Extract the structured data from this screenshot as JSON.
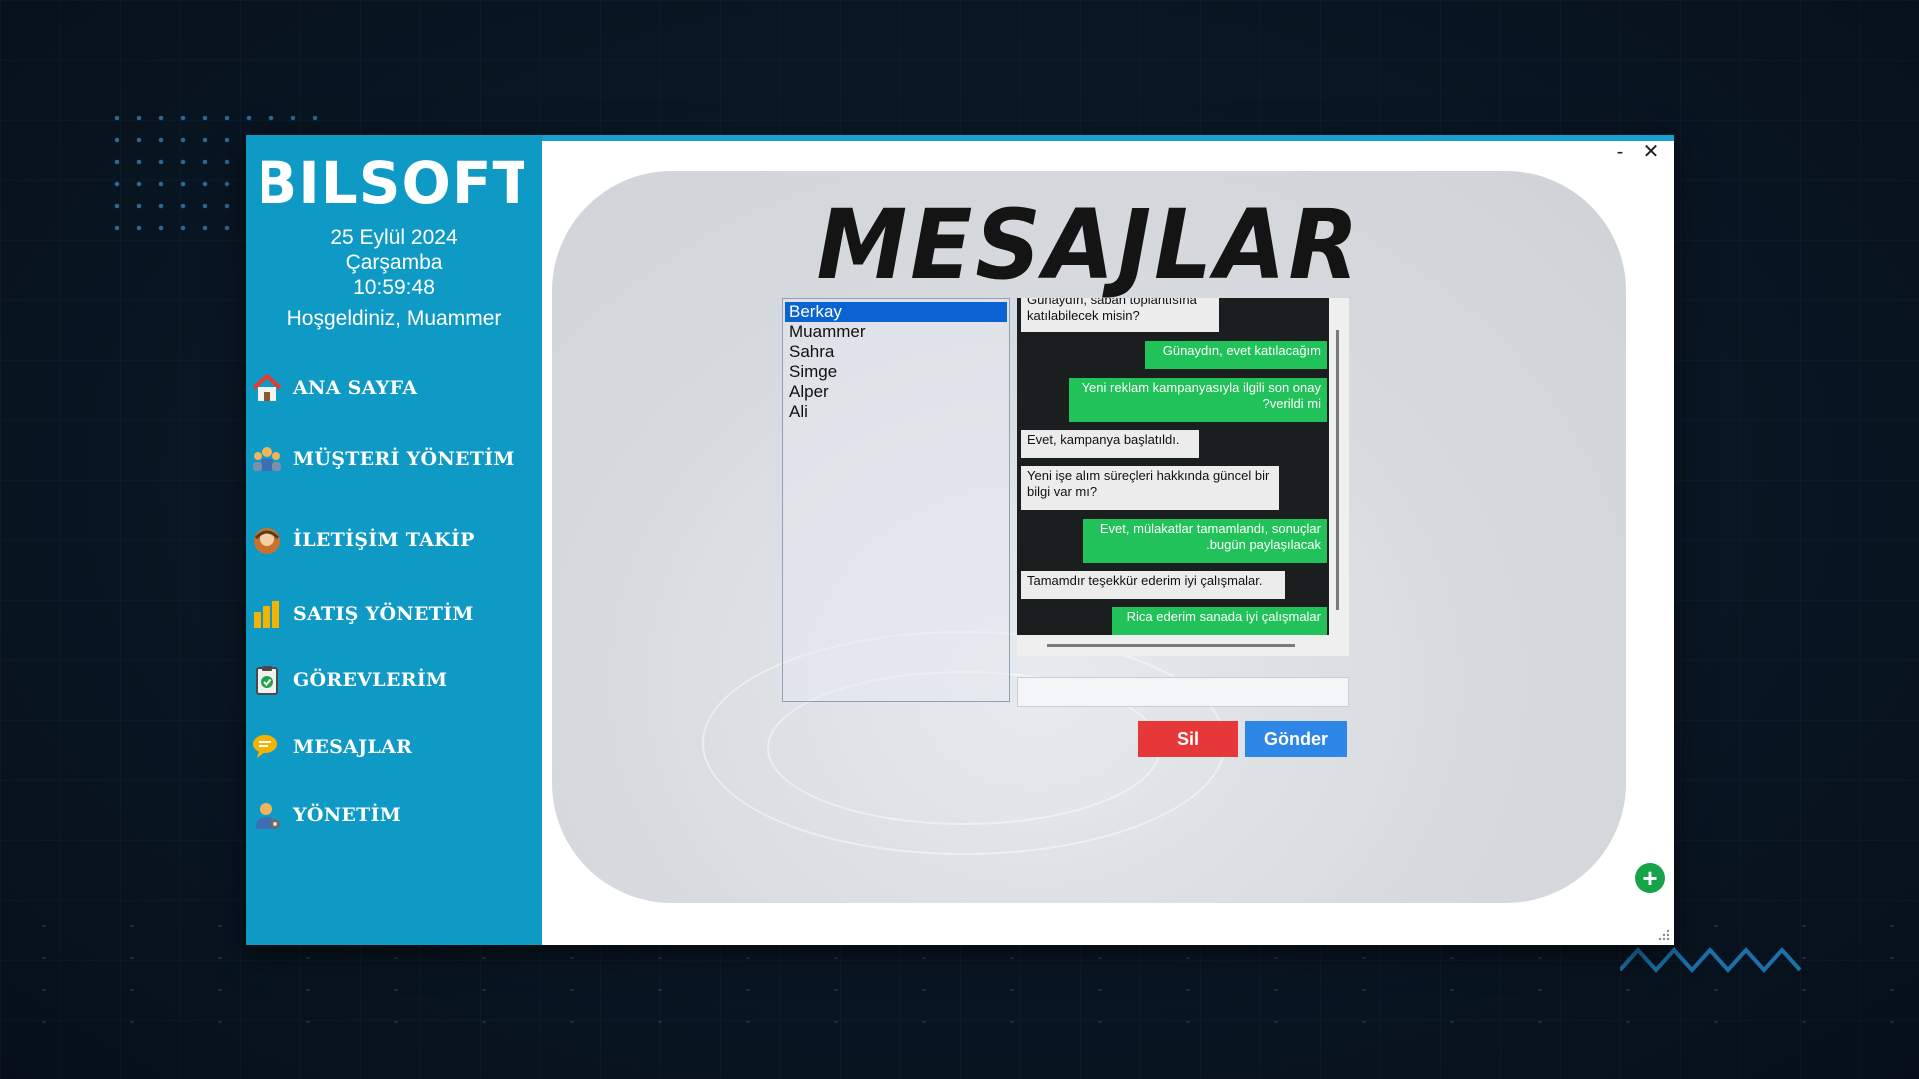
{
  "app": {
    "logo_text": "BILSOFT",
    "date": "25 Eylül 2024",
    "weekday": "Çarşamba",
    "time": "10:59:48",
    "welcome": "Hoşgeldiniz, Muammer"
  },
  "nav": {
    "items": [
      {
        "label": "ANA SAYFA",
        "icon": "home-icon"
      },
      {
        "label": "MÜŞTERİ YÖNETİM",
        "icon": "customers-icon"
      },
      {
        "label": "İLETİŞİM TAKİP",
        "icon": "contact-icon"
      },
      {
        "label": "SATIŞ YÖNETİM",
        "icon": "sales-chart-icon"
      },
      {
        "label": "GÖREVLERİM",
        "icon": "clipboard-icon"
      },
      {
        "label": "MESAJLAR",
        "icon": "chat-icon"
      },
      {
        "label": "YÖNETİM",
        "icon": "admin-icon"
      }
    ]
  },
  "window_controls": {
    "minimize": "-",
    "close": "✕"
  },
  "page": {
    "title": "MESAJLAR"
  },
  "contacts": {
    "selected": "Berkay",
    "items": [
      "Berkay",
      "Muammer",
      "Sahra",
      "Simge",
      "Alper",
      "Ali"
    ]
  },
  "messages": [
    {
      "from": "in",
      "text": "Günaydın, sabah toplantısına katılabilecek misin?"
    },
    {
      "from": "out",
      "text": "Günaydın, evet katılacağım"
    },
    {
      "from": "out",
      "text": "Yeni reklam kampanyasıyla ilgili son onay ?verildi mi"
    },
    {
      "from": "in",
      "text": "Evet, kampanya başlatıldı."
    },
    {
      "from": "in",
      "text": "Yeni işe alım süreçleri hakkında güncel bir bilgi var mı?"
    },
    {
      "from": "out",
      "text": "Evet, mülakatlar tamamlandı, sonuçlar .bugün paylaşılacak"
    },
    {
      "from": "in",
      "text": "Tamamdır teşekkür ederim iyi çalışmalar."
    },
    {
      "from": "out",
      "text": "Rica ederim sanada iyi çalışmalar"
    }
  ],
  "compose": {
    "value": "",
    "placeholder": ""
  },
  "buttons": {
    "delete": "Sil",
    "send": "Gönder",
    "add": "+"
  },
  "colors": {
    "sidebar": "#0f9ac6",
    "outgoing_bubble": "#22c25a",
    "incoming_bubble": "#ececec",
    "delete_button": "#e63838",
    "send_button": "#2e86e6",
    "selected_contact": "#0a63d0"
  }
}
